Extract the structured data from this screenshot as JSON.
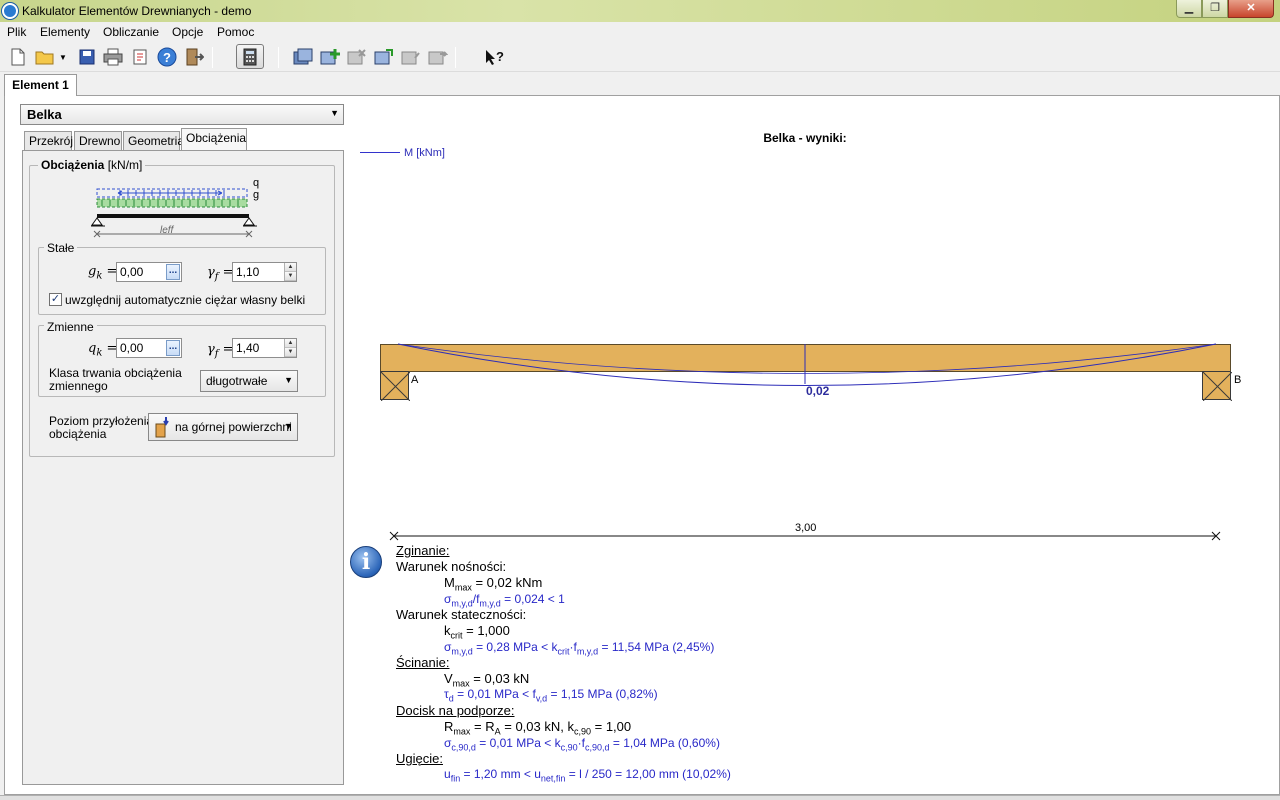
{
  "window": {
    "title": "Kalkulator Elementów Drewnianych - demo",
    "min": "▁",
    "max": "❐",
    "close": "✕"
  },
  "menu": [
    "Plik",
    "Elementy",
    "Obliczanie",
    "Opcje",
    "Pomoc"
  ],
  "element_tab": "Element 1",
  "element_type": "Belka",
  "tabs": [
    "Przekrój",
    "Drewno",
    "Geometria",
    "Obciążenia"
  ],
  "loads": {
    "title": "Obciążenia",
    "unit": "[kN/m]",
    "diagram": {
      "q": "q",
      "g": "g",
      "leff": "leff"
    },
    "permanent": {
      "title": "Stałe",
      "gk_label": "g",
      "gk_sub": "k",
      "gk_value": "0,00",
      "gamma_label": "γ",
      "gamma_sub": "f",
      "gamma_value": "1,10",
      "self_weight_checked": true,
      "self_weight_label": "uwzględnij automatycznie ciężar własny belki"
    },
    "variable": {
      "title": "Zmienne",
      "qk_label": "q",
      "qk_sub": "k",
      "qk_value": "0,00",
      "gamma_label": "γ",
      "gamma_sub": "f",
      "gamma_value": "1,40",
      "duration_label_1": "Klasa trwania obciążenia",
      "duration_label_2": "zmiennego",
      "duration_value": "długotrwałe"
    },
    "level_label_1": "Poziom przyłożenia",
    "level_label_2": "obciążenia",
    "level_value": "na górnej powierzchni"
  },
  "results": {
    "title": "Belka - wyniki:",
    "legend": "M [kNm]",
    "support_a": "A",
    "support_b": "B",
    "max_value": "0,02",
    "span": "3,00",
    "colors": {
      "moment": "#2d2db8",
      "beam": "#e3b15c"
    }
  },
  "text": {
    "bending": "Zginanie:",
    "capacity": "Warunek nośności:",
    "mmax": "M",
    "mmax_sub": "max",
    "mmax_val": " = 0,02 kNm",
    "sig_ratio_a": "σ",
    "sig_ratio_a_sub": "m,y,d",
    "sig_ratio_b": "/f",
    "sig_ratio_b_sub": "m,y,d",
    "sig_ratio_val": " = 0,024  <  1",
    "stability": "Warunek stateczności:",
    "kcrit": "k",
    "kcrit_sub": "crit",
    "kcrit_val": " = 1,000",
    "stab_a": "σ",
    "stab_a_sub": "m,y,d",
    "stab_mid": " = 0,28 MPa   <   k",
    "stab_k_sub": "crit",
    "stab_f": "·f",
    "stab_f_sub": "m,y,d",
    "stab_end": " = 11,54 MPa     (2,45%)",
    "shear": "Ścinanie:",
    "vmax": "V",
    "vmax_sub": "max",
    "vmax_val": " = 0,03 kN",
    "tau": "τ",
    "tau_sub": "d",
    "tau_mid": " = 0,01 MPa   <   f",
    "tau_f_sub": "v,d",
    "tau_end": " = 1,15 MPa     (0,82%)",
    "bearing": "Docisk na podporze:",
    "rmax": "R",
    "rmax_sub": "max",
    "rmax_mid": " = R",
    "ra_sub": "A",
    "rmax_end": " = 0,03 kN,        k",
    "kc_sub": "c,90",
    "kc_val": " = 1,00",
    "bear_a": "σ",
    "bear_a_sub": "c,90,d",
    "bear_mid": " = 0,01 MPa   <   k",
    "bear_k_sub": "c,90",
    "bear_f": "·f",
    "bear_f_sub": "c,90,d",
    "bear_end": " = 1,04 MPa     (0,60%)",
    "deflection": "Ugięcie:",
    "ufin": "u",
    "ufin_sub": "fin",
    "ufin_mid": " = 1,20 mm   <   u",
    "unet_sub": "net,fin",
    "ufin_end": " = l / 250 = 12,00 mm     (10,02%)"
  }
}
